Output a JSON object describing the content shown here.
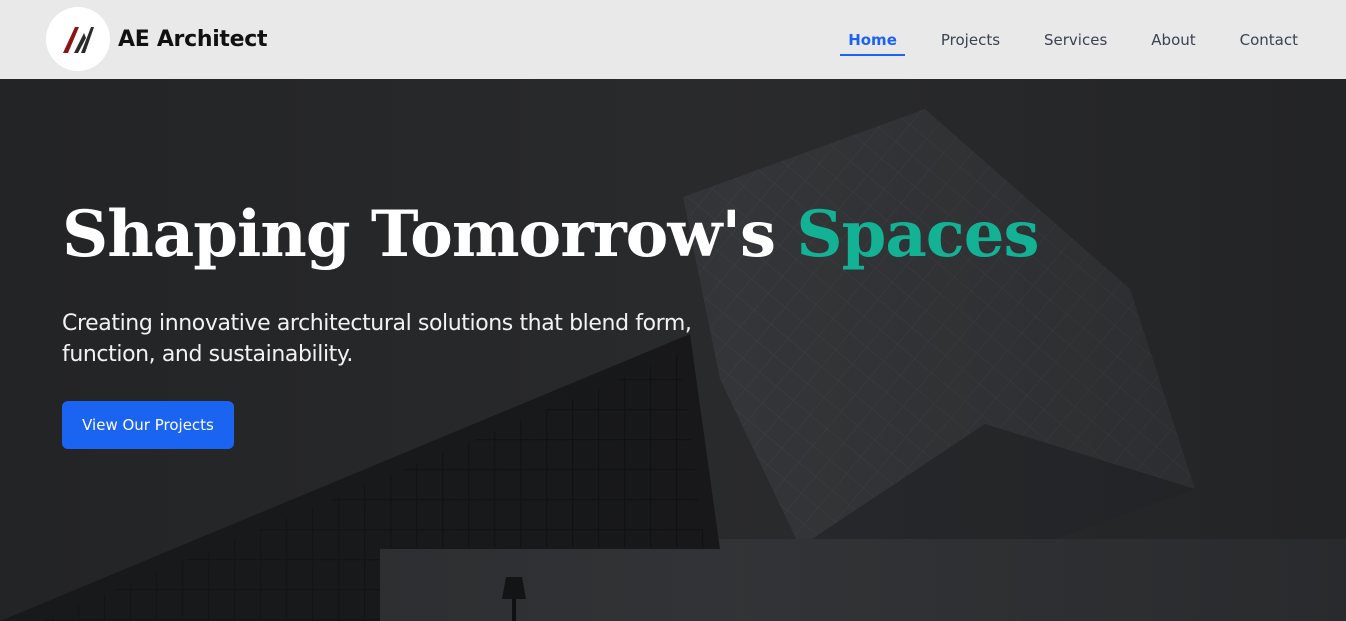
{
  "header": {
    "brand_name": "AE Architect",
    "logo_icon": "ae-monogram-logo"
  },
  "nav": {
    "items": [
      {
        "label": "Home",
        "active": true
      },
      {
        "label": "Projects",
        "active": false
      },
      {
        "label": "Services",
        "active": false
      },
      {
        "label": "About",
        "active": false
      },
      {
        "label": "Contact",
        "active": false
      }
    ]
  },
  "hero": {
    "title_main": "Shaping Tomorrow's",
    "title_accent": "Spaces",
    "subtitle": "Creating innovative architectural solutions that blend form, function, and sustainability.",
    "cta_label": "View Our Projects",
    "background_image": "modern-glass-building-photo"
  },
  "colors": {
    "accent": "#1b64f2",
    "title_accent": "#13b295",
    "nav_background": "#e9e9ea"
  }
}
